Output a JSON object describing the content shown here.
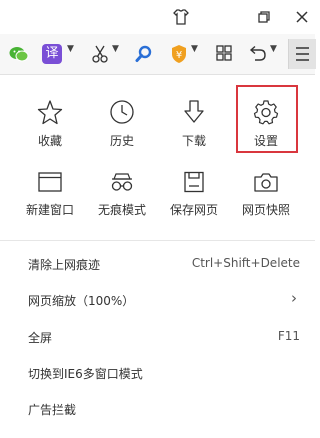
{
  "window": {
    "skin_label": "skin",
    "restore_label": "restore",
    "close_label": "close"
  },
  "toolbar": {
    "translate_label": "译"
  },
  "grid": [
    {
      "label": "收藏",
      "icon": "star-icon"
    },
    {
      "label": "历史",
      "icon": "clock-icon"
    },
    {
      "label": "下载",
      "icon": "download-arrow-icon"
    },
    {
      "label": "设置",
      "icon": "gear-icon"
    },
    {
      "label": "新建窗口",
      "icon": "new-window-icon"
    },
    {
      "label": "无痕模式",
      "icon": "incognito-glasses-icon"
    },
    {
      "label": "保存网页",
      "icon": "save-page-icon"
    },
    {
      "label": "网页快照",
      "icon": "camera-icon"
    }
  ],
  "menu": [
    {
      "label": "清除上网痕迹",
      "shortcut": "Ctrl+Shift+Delete"
    },
    {
      "label": "网页缩放（100%）",
      "shortcut": "›"
    },
    {
      "label": "全屏",
      "shortcut": "F11"
    },
    {
      "label": "切换到IE6多窗口模式",
      "shortcut": ""
    },
    {
      "label": "广告拦截",
      "shortcut": ""
    }
  ],
  "colors": {
    "highlight_border": "#d9363e",
    "translate_bg": "#7a4fd6",
    "search_blue": "#2a6fd6",
    "shield_orange": "#f0a020",
    "wechat_green": "#48b334"
  }
}
